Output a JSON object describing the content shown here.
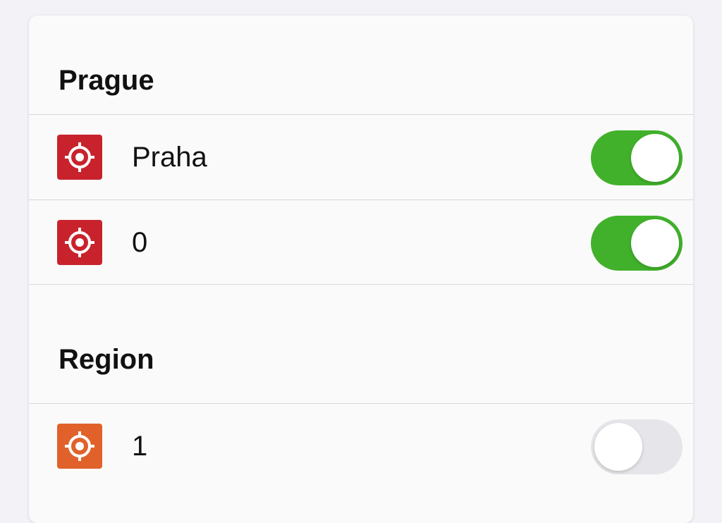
{
  "sections": [
    {
      "title": "Prague",
      "items": [
        {
          "label": "Praha",
          "enabled": true,
          "icon": "crosshair-icon",
          "icon_color": "#c8232c"
        },
        {
          "label": "0",
          "enabled": true,
          "icon": "crosshair-icon",
          "icon_color": "#c8232c"
        }
      ]
    },
    {
      "title": "Region",
      "items": [
        {
          "label": "1",
          "enabled": false,
          "icon": "crosshair-icon",
          "icon_color": "#e0622a"
        }
      ]
    }
  ],
  "colors": {
    "toggle_on": "#41b12b",
    "toggle_off": "#e6e6ea"
  }
}
